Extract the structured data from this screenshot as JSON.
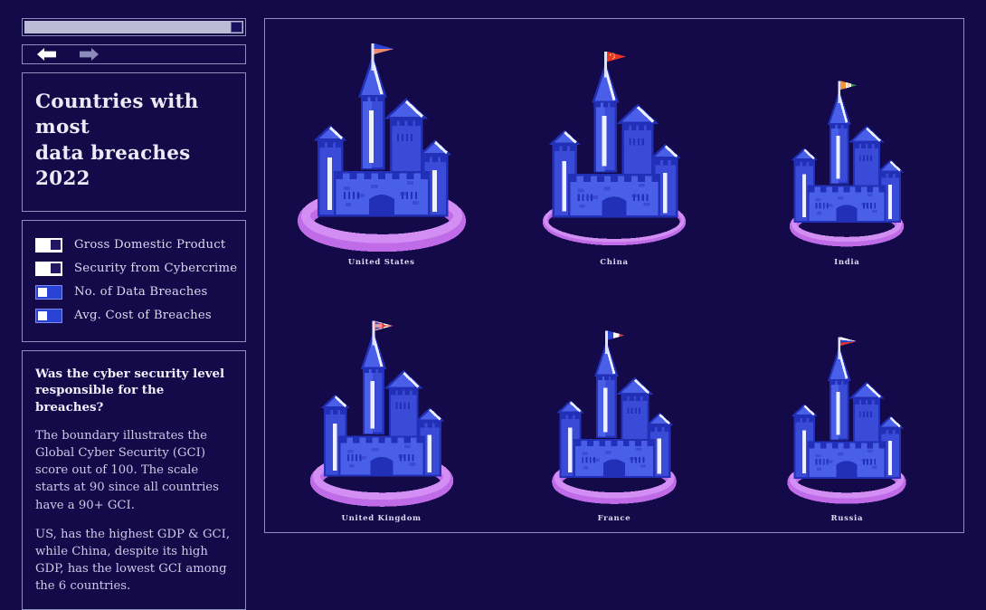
{
  "window": {
    "progress": {
      "name": "timeline-scrollbar",
      "value": 100,
      "handle_position": "right"
    },
    "nav": {
      "back_label": "Back",
      "forward_label": "Forward",
      "back_state": "enabled",
      "forward_state": "disabled",
      "back_color": "#ffffff",
      "forward_color": "#8c8ab8"
    }
  },
  "header": {
    "title_line_1": "Countries with most",
    "title_line_2": "data breaches 2022",
    "title": "Countries with most data breaches 2022"
  },
  "legend": {
    "items": [
      {
        "label": "Gross Domestic Product",
        "state": "on",
        "encoding": "castle-size"
      },
      {
        "label": "Security from Cybercrime",
        "state": "on",
        "encoding": "ring-thickness"
      },
      {
        "label": "No. of Data Breaches",
        "state": "off",
        "encoding": "none"
      },
      {
        "label": "Avg. Cost of Breaches",
        "state": "off",
        "encoding": "none"
      }
    ]
  },
  "notes": {
    "heading": "Was the cyber security level responsible for the breaches?",
    "paragraph_1": "The boundary illustrates the Global Cyber Security (GCI) score out of 100. The scale starts at 90 since all countries have a 90+ GCI.",
    "paragraph_2": "US, has the highest GDP & GCI, while China, despite its high GDP, has the lowest GCI among the 6 countries."
  },
  "colors": {
    "background": "#140a4a",
    "panel_border": "#8f8dbe",
    "castle_light": "#4a5fe8",
    "castle_mid": "#3a4bd8",
    "castle_dark": "#2230b8",
    "castle_shade": "#5566ee",
    "ring": "#c06ce8",
    "ring_light": "#d28ef2",
    "toggle_on_bg": "#ffffff",
    "toggle_off_bg": "#2a41d6",
    "text_primary": "#eceaf7",
    "text_body": "#cdc9e6"
  },
  "chart_data": {
    "type": "bar",
    "title": "Countries with most data breaches 2022",
    "xlabel": "",
    "ylabel": "",
    "encoding_notes": {
      "castle_size": "Gross Domestic Product",
      "ring_thickness": "Global Cyber Security Index (GCI) score, scale starts at 90"
    },
    "categories": [
      "United States",
      "China",
      "India",
      "United Kingdom",
      "France",
      "Russia"
    ],
    "series": [
      {
        "name": "Gross Domestic Product (castle size)",
        "values": [
          100,
          92,
          64,
          72,
          70,
          62
        ]
      },
      {
        "name": "Security from Cybercrime (GCI ring)",
        "values": [
          100,
          92,
          97,
          99,
          98,
          98
        ]
      }
    ],
    "countries": [
      {
        "name": "United States",
        "flag": "us",
        "castle_scale": 1.0,
        "ring_thickness": 18,
        "ring_width": 168,
        "gci": 100
      },
      {
        "name": "China",
        "flag": "cn",
        "castle_scale": 0.96,
        "ring_thickness": 7,
        "ring_width": 158,
        "gci": 92
      },
      {
        "name": "India",
        "flag": "in",
        "castle_scale": 0.82,
        "ring_thickness": 12,
        "ring_width": 142,
        "gci": 97
      },
      {
        "name": "United Kingdom",
        "flag": "gb",
        "castle_scale": 0.9,
        "ring_thickness": 16,
        "ring_width": 160,
        "gci": 99
      },
      {
        "name": "France",
        "flag": "fr",
        "castle_scale": 0.85,
        "ring_thickness": 14,
        "ring_width": 148,
        "gci": 98
      },
      {
        "name": "Russia",
        "flag": "ru",
        "castle_scale": 0.82,
        "ring_thickness": 14,
        "ring_width": 146,
        "gci": 98
      }
    ],
    "flag_colors": {
      "us": [
        "#2b44d4",
        "#f08a6e"
      ],
      "cn": [
        "#e8342a",
        "#f5d438"
      ],
      "in": [
        "#f29339",
        "#ffffff",
        "#2f9e5a"
      ],
      "gb": [
        "#ffffff",
        "#e8342a",
        "#2b44d4"
      ],
      "fr": [
        "#2b44d4",
        "#ffffff",
        "#e8342a"
      ],
      "ru": [
        "#ffffff",
        "#2b44d4",
        "#e8342a"
      ]
    }
  }
}
